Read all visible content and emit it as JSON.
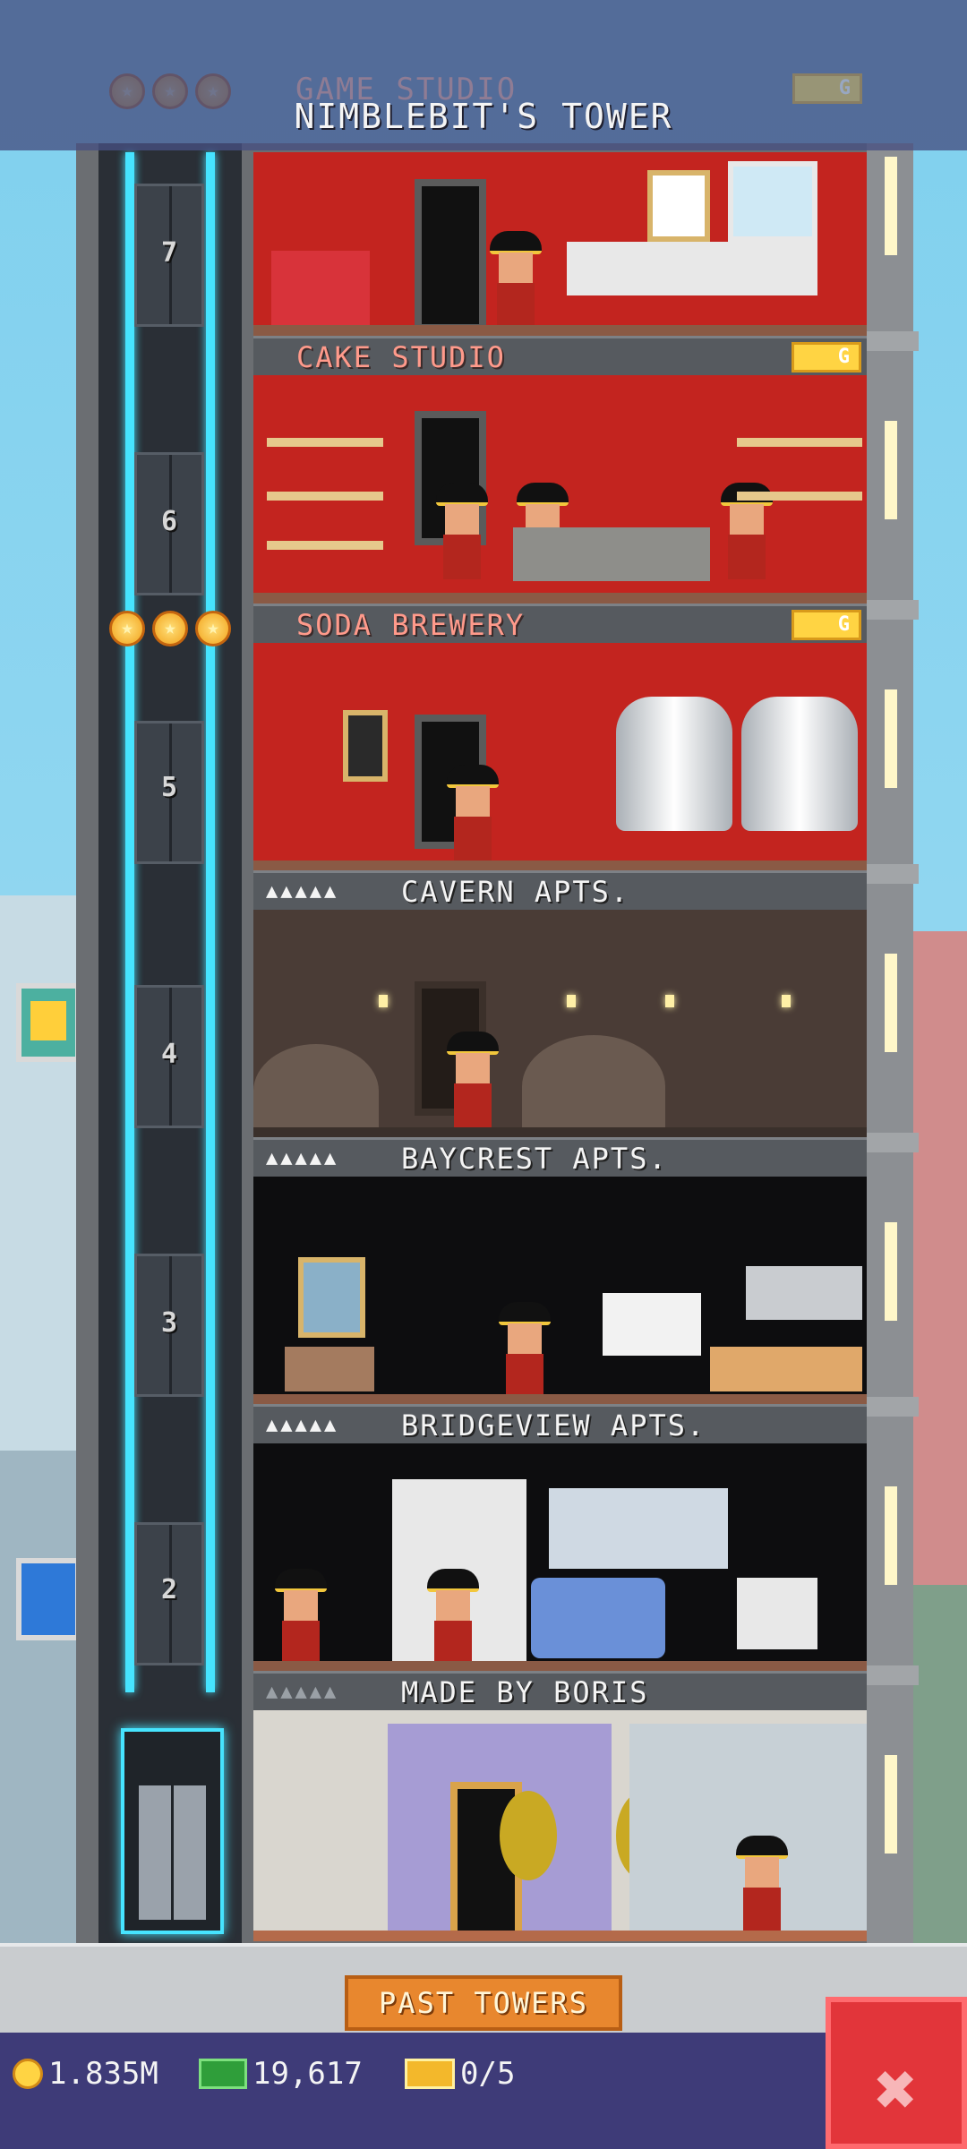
{
  "header": {
    "title": "NIMBLEBIT'S TOWER",
    "ghost_floor": "GAME STUDIO"
  },
  "elevator": {
    "floor_numbers": [
      "7",
      "6",
      "5",
      "4",
      "3",
      "2"
    ]
  },
  "floors": [
    {
      "name": "CAKE STUDIO",
      "badge": "G",
      "kind": "business"
    },
    {
      "name": "SODA BREWERY",
      "badge": "G",
      "kind": "business"
    },
    {
      "name": "CAVERN APTS.",
      "stars": "▲▲▲▲▲",
      "kind": "residential"
    },
    {
      "name": "BAYCREST APTS.",
      "stars": "▲▲▲▲▲",
      "kind": "residential"
    },
    {
      "name": "BRIDGEVIEW APTS.",
      "stars": "▲▲▲▲▲",
      "kind": "residential"
    },
    {
      "name": "MADE BY BORIS",
      "stars": "▲▲▲▲▲",
      "kind": "lobby"
    }
  ],
  "top_floor_badge": "G",
  "bottom": {
    "past_towers_label": "PAST TOWERS",
    "coins": "1.835M",
    "bux": "19,617",
    "tickets": "0/5",
    "close_label": "✖"
  },
  "colors": {
    "accent_orange": "#e8872e",
    "status_bar": "#3e3b78",
    "close_red": "#e2353a",
    "elevator_cable": "#46e4ff"
  }
}
